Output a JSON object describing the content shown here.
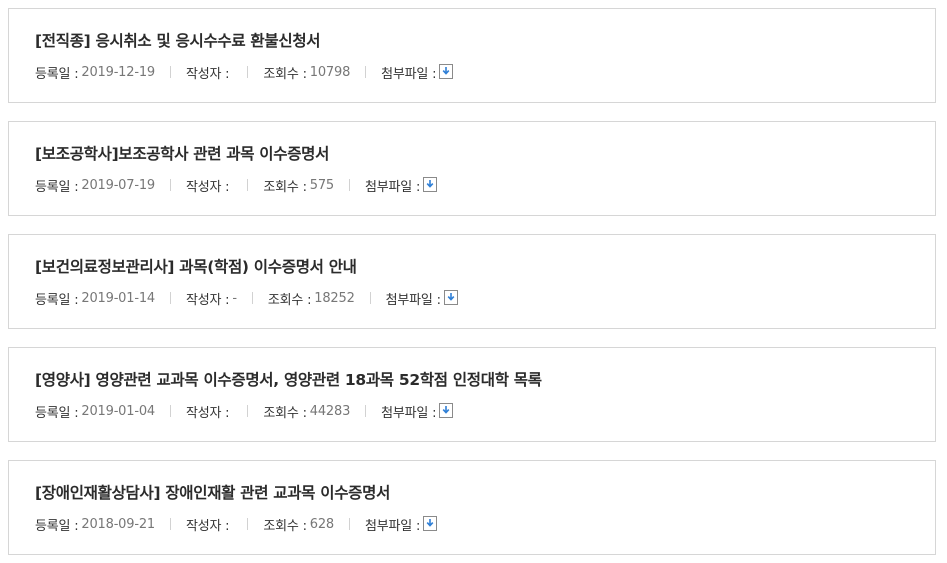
{
  "labels": {
    "date": "등록일 :",
    "author": "작성자 :",
    "views": "조회수 :",
    "attachment": "첨부파일 :"
  },
  "icons": {
    "download": "download-icon"
  },
  "colors": {
    "download_arrow": "#2f7fd6"
  },
  "posts": [
    {
      "title": "[전직종] 응시취소 및 응시수수료 환불신청서",
      "date": "2019-12-19",
      "author": "",
      "views": "10798"
    },
    {
      "title": "[보조공학사]보조공학사 관련 과목 이수증명서",
      "date": "2019-07-19",
      "author": "",
      "views": "575"
    },
    {
      "title": "[보건의료정보관리사] 과목(학점) 이수증명서 안내",
      "date": "2019-01-14",
      "author": "-",
      "views": "18252"
    },
    {
      "title": "[영양사] 영양관련 교과목 이수증명서, 영양관련 18과목 52학점 인정대학 목록",
      "date": "2019-01-04",
      "author": "",
      "views": "44283"
    },
    {
      "title": "[장애인재활상담사] 장애인재활 관련 교과목 이수증명서",
      "date": "2018-09-21",
      "author": "",
      "views": "628"
    }
  ]
}
